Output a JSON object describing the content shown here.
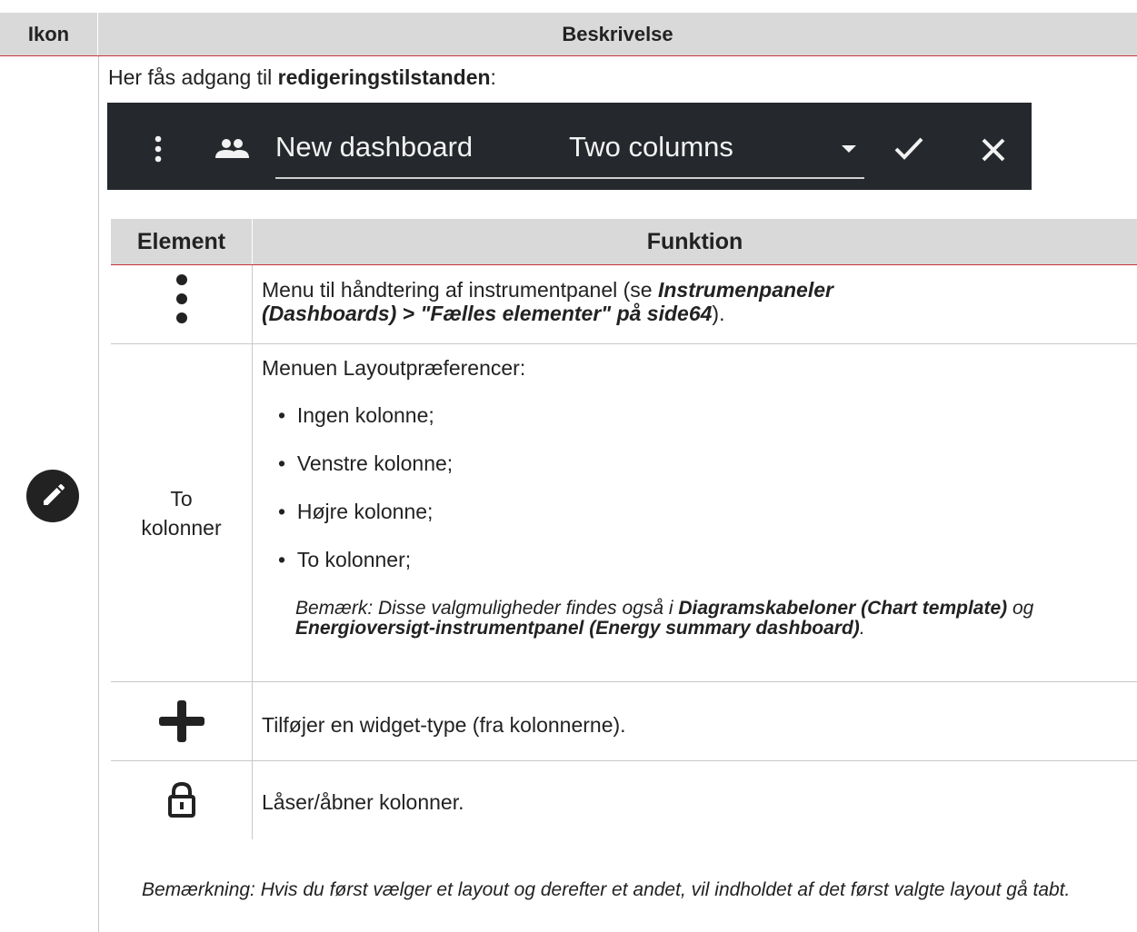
{
  "outer_table": {
    "col_icon": "Ikon",
    "col_desc": "Beskrivelse"
  },
  "intro": {
    "prefix": "Her fås adgang til ",
    "bold": "redigeringstilstanden",
    "suffix": ":"
  },
  "toolbar": {
    "icons": [
      "more-vert-icon",
      "people-icon",
      "dropdown-arrow-icon",
      "check-icon",
      "close-icon"
    ],
    "dashboard_name": "New dashboard",
    "layout_value": "Two columns",
    "colors": {
      "background": "#25282c",
      "text": "#f2f2f2"
    }
  },
  "inner_table": {
    "col_element": "Element",
    "col_function": "Funktion",
    "rows": {
      "menu": {
        "icon": "more-vert-icon",
        "text_prefix": "Menu til håndtering af instrumentpanel (se ",
        "link_line1": "Instrumenpaneler",
        "link_line2": "(Dashboards) > \"Fælles elementer\" på side64",
        "text_suffix": ")."
      },
      "layout": {
        "element_line1": "To",
        "element_line2": "kolonner",
        "heading": "Menuen Layoutpræferencer:",
        "options": [
          "Ingen kolonne;",
          "Venstre kolonne;",
          "Højre kolonne;",
          "To kolonner;"
        ],
        "note_prefix": "Bemærk: Disse valgmuligheder findes også i ",
        "note_bold1": "Diagramskabeloner (Chart template)",
        "note_mid": " og ",
        "note_bold2": "Energioversigt-instrumentpanel (Energy summary dashboard)",
        "note_suffix": "."
      },
      "add": {
        "icon": "plus-icon",
        "text": "Tilføjer en widget-type (fra kolonnerne)."
      },
      "lock": {
        "icon": "lock-open-icon",
        "text": "Låser/åbner kolonner."
      }
    }
  },
  "row_icon": "pencil-edit-icon",
  "footnote": "Bemærkning: Hvis du først vælger et layout og derefter et andet, vil indholdet af det først valgte layout gå tabt.",
  "colors": {
    "header_bg": "#d9d9d9",
    "accent_red": "#c8323c",
    "icon_dark": "#222222"
  }
}
